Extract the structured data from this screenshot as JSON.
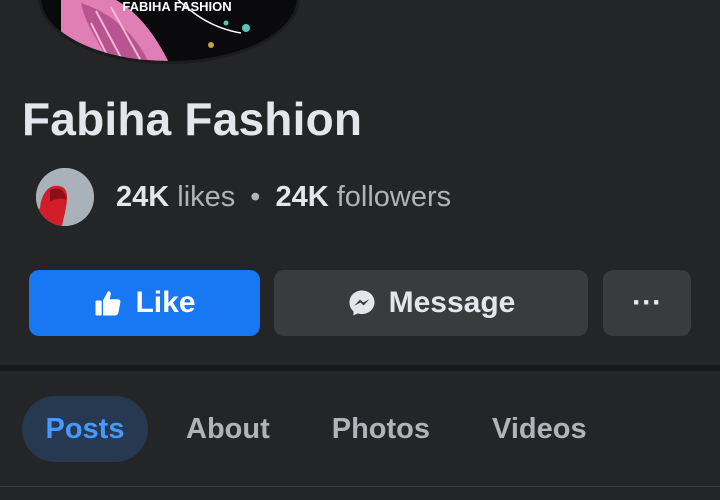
{
  "profile": {
    "cover_text": "FABIHA FASHION",
    "name": "Fabiha Fashion"
  },
  "stats": {
    "likes_count": "24K",
    "likes_label": "likes",
    "separator": "•",
    "followers_count": "24K",
    "followers_label": "followers"
  },
  "actions": {
    "like_label": "Like",
    "message_label": "Message",
    "more_label": "···"
  },
  "tabs": [
    {
      "label": "Posts",
      "selected": true
    },
    {
      "label": "About",
      "selected": false
    },
    {
      "label": "Photos",
      "selected": false
    },
    {
      "label": "Videos",
      "selected": false
    }
  ],
  "icons": {
    "like": "thumbs-up-icon",
    "message": "messenger-icon",
    "more": "more-icon"
  },
  "colors": {
    "background": "#242526",
    "like_button": "#1877f2",
    "secondary_button": "#3a3b3c",
    "selected_tab_bg": "#263951",
    "selected_tab_text": "#4599ff",
    "primary_text": "#e4e6eb",
    "secondary_text": "#b0b3b8"
  }
}
